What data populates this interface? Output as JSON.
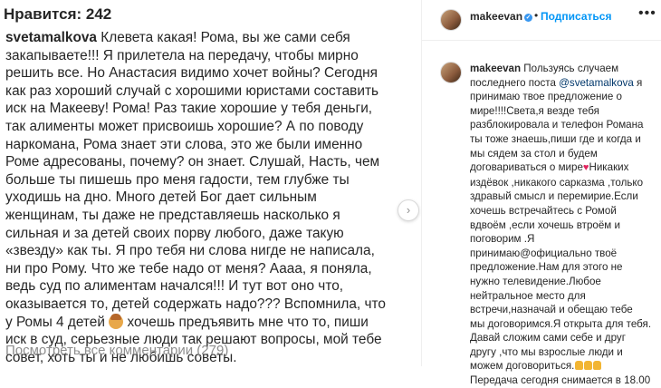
{
  "left": {
    "likes": "Нравится: 242",
    "comment_user": "svetamalkova",
    "comment_text_1": " Клевета какая! Рома, вы же сами себя\nзакапываете!!! Я прилетела на передачу, чтобы мирно\nрешить все. Но Анастасия видимо хочет войны? Сегодня\nкак раз хороший случай с хорошими юристами составить\nиск на Макееву! Рома! Раз такие хорошие у тебя деньги,\nтак алименты может присвоишь хорошие? А по поводу\nнаркомана, Рома знает эти слова, это же были именно\nРоме адресованы, почему? он знает. Слушай, Насть, чем\nбольше ты пишешь про меня гадости, тем глубже ты\nуходишь на дно. Много детей Бог дает сильным\nженщинам, ты даже не представляешь насколько я\nсильная и за детей своих порву любого,  даже такую\n«звезду» как ты. Я про тебя ни слова нигде не написала,\nни про Рому. Что же тебе надо от меня? Аааа, я поняла,\nведь суд по алиментам начался!!! И тут вот оно что,\nоказывается то, детей содержать надо??? Вспомнила, что\nу Ромы 4 детей ",
    "comment_text_2": " хочешь предъявить мне что то, пиши\nиск в суд, серьезные люди так решают вопросы, мой тебе\nсовет, хоть ты и не любишь советы.",
    "view_all": "Посмотреть все комментарии (279)",
    "nav_arrow": "›"
  },
  "right": {
    "username": "makeevan",
    "verified_glyph": "✓",
    "dot": "•",
    "follow_label": "Подписаться",
    "more_glyph": "•••",
    "caption_user": "makeevan",
    "caption_part_1": " Пользуясь случаем\nпоследнего поста ",
    "caption_mention": "@svetamalkova",
    "caption_part_2": " я\nпринимаю твое предложение о\nмире!!!!Света,я везде тебя\nразблокировала и телефон Романа\nты тоже знаешь,пиши где и когда и\nмы сядем за стол и будем\nдоговариваться о мире",
    "caption_heart": "♥",
    "caption_part_3": "Никаких\nиздёвок ,никакого сарказма ,только\nздравый смысл и перемирие.Если\nхочешь встречайтесь с Ромой\nвдвоём ,если хочешь втроём и\nпоговорим .Я\nпринимаю@официально твоё\nпредложение.Нам для этого не\nнужно телевидение.Любое\nнейтральное место для\nвстречи,назначай и обещаю тебе\nмы договоримся.Я открыта для тебя.\nДавай сложим сами себе и друг\nдругу ,что мы взрослые люди и\nможем договориться.",
    "caption_part_4": "\nПередача сегодня снимается в 18.00"
  },
  "colors": {
    "accent_blue": "#0095f6",
    "mention": "#00376b",
    "muted": "#8e8e8e",
    "heart": "#e0245e"
  }
}
